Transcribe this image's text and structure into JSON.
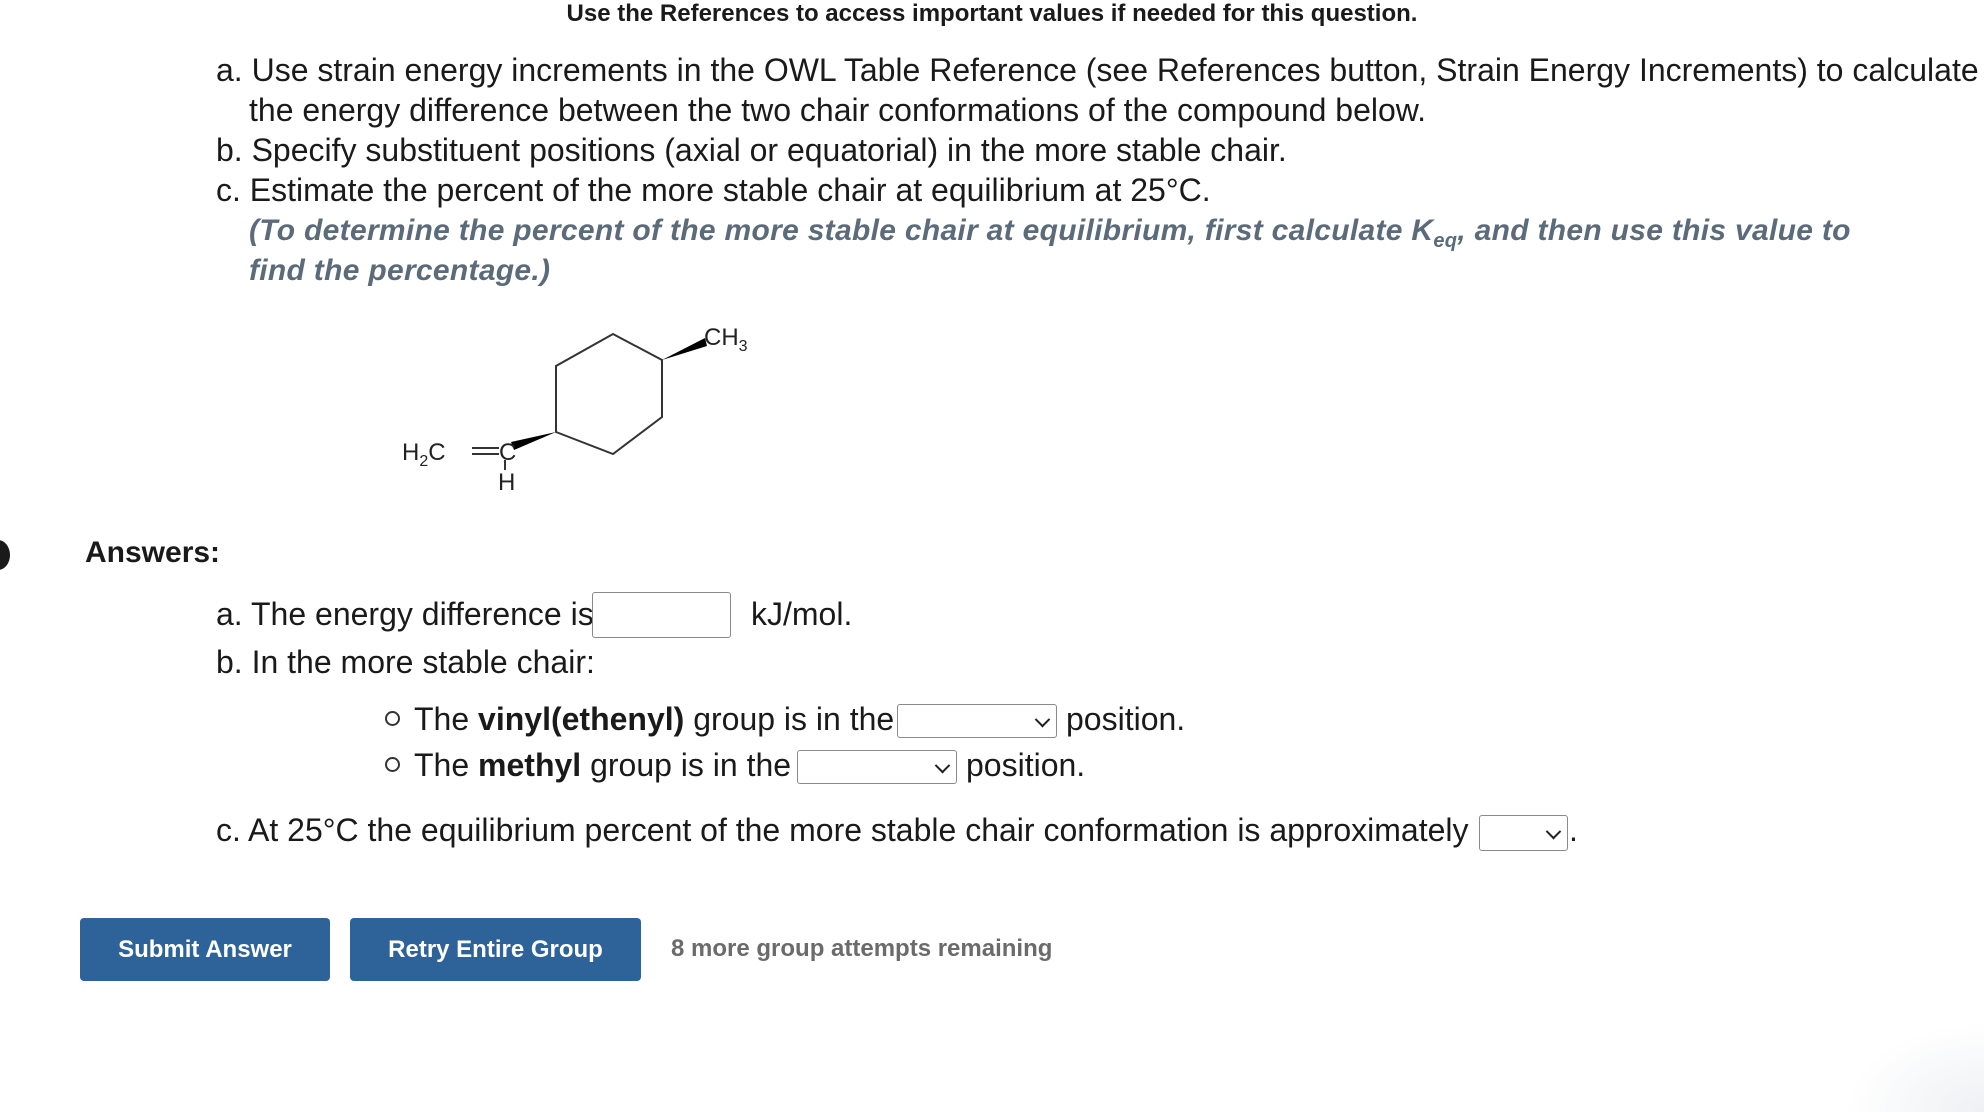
{
  "header": {
    "references_note": "Use the References to access important values if needed for this question."
  },
  "question": {
    "part_a_line1": "a. Use strain energy increments in the OWL Table Reference (see References button, Strain Energy Increments) to calculate",
    "part_a_line2": "the energy difference between the two chair conformations of the compound below.",
    "part_b": "b. Specify substituent positions (axial or equatorial) in the more stable chair.",
    "part_c": "c. Estimate the percent of the more stable chair at equilibrium at 25°C.",
    "hint_line1_before": "(To determine the percent of the more stable chair at equilibrium, first calculate K",
    "hint_sub": "eq",
    "hint_line1_after": ", and then use this value to",
    "hint_line2": "find the percentage.)"
  },
  "structure": {
    "methyl_label": "CH",
    "methyl_sub": "3",
    "vinyl_left_H": "H",
    "vinyl_left_sub": "2",
    "vinyl_left_C": "C",
    "vinyl_right_C": "C",
    "vinyl_H": "H"
  },
  "answers": {
    "label": "Answers:",
    "a_prefix": "a. The energy difference is",
    "a_value": "",
    "a_unit": "kJ/mol.",
    "b_intro": "b. In the more stable chair:",
    "b_vinyl_pre": "The ",
    "b_vinyl_bold": "vinyl(ethenyl)",
    "b_vinyl_post": " group is in the",
    "b_vinyl_selected": "",
    "b_position1": "position.",
    "b_methyl_pre": "The ",
    "b_methyl_bold": "methyl",
    "b_methyl_post": " group is in the",
    "b_methyl_selected": "",
    "b_position2": "position.",
    "c_text": "c. At 25°C the equilibrium percent of the more stable chair conformation is approximately",
    "c_selected": "",
    "c_period": "."
  },
  "buttons": {
    "submit": "Submit Answer",
    "retry": "Retry Entire Group",
    "attempts": "8 more group attempts remaining"
  },
  "colors": {
    "button_bg": "#2e6399",
    "hint_text": "#5b6b7a",
    "attempts_text": "#6b6b6b"
  }
}
